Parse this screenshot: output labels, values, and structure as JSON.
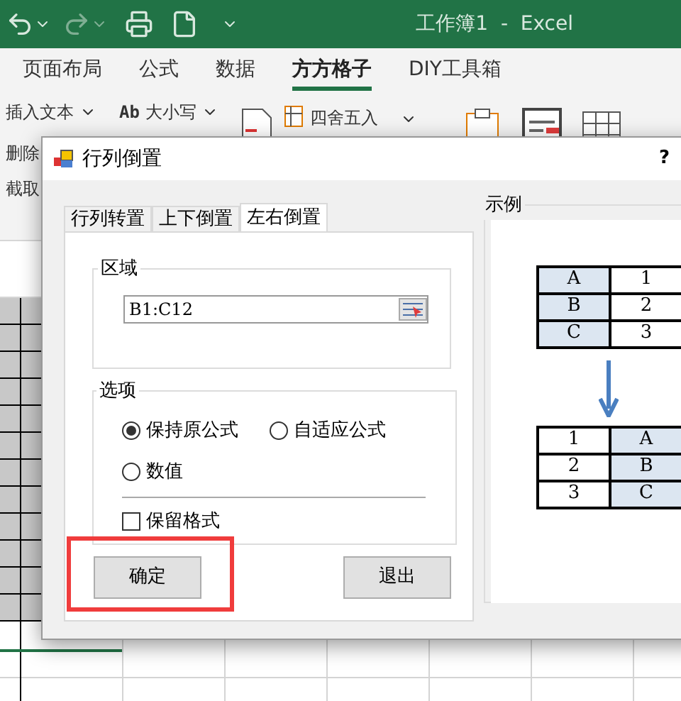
{
  "app": {
    "title": "工作簿1  -  Excel"
  },
  "ribbon_tabs": [
    {
      "label": "页面布局",
      "selected": false
    },
    {
      "label": "公式",
      "selected": false
    },
    {
      "label": "数据",
      "selected": false
    },
    {
      "label": "方方格子",
      "selected": true
    },
    {
      "label": "DIY工具箱",
      "selected": false
    }
  ],
  "ribbon_items": [
    {
      "label": "插入文本"
    },
    {
      "label": "大小写",
      "prefix": "Ab"
    },
    {
      "label": "四舍五入"
    }
  ],
  "ribbon_side_items": [
    "删除",
    "截取"
  ],
  "dialog": {
    "title": "行列倒置",
    "help": "?",
    "tabs": [
      {
        "label": "行列转置",
        "selected": false
      },
      {
        "label": "上下倒置",
        "selected": false
      },
      {
        "label": "左右倒置",
        "selected": true
      }
    ],
    "region": {
      "label": "区域",
      "value": "B1:C12"
    },
    "options": {
      "label": "选项",
      "radios": [
        {
          "label": "保持原公式",
          "selected": true
        },
        {
          "label": "自适应公式",
          "selected": false
        },
        {
          "label": "数值",
          "selected": false
        }
      ],
      "checkbox": {
        "label": "保留格式",
        "checked": false
      }
    },
    "buttons": [
      {
        "label": "确定",
        "highlighted": true
      },
      {
        "label": "退出",
        "highlighted": false
      }
    ],
    "example": {
      "label": "示例",
      "before": [
        [
          {
            "text": "A",
            "shaded": true
          },
          {
            "text": "1",
            "shaded": false
          }
        ],
        [
          {
            "text": "B",
            "shaded": true
          },
          {
            "text": "2",
            "shaded": false
          }
        ],
        [
          {
            "text": "C",
            "shaded": true
          },
          {
            "text": "3",
            "shaded": false
          }
        ]
      ],
      "after": [
        [
          {
            "text": "1",
            "shaded": false
          },
          {
            "text": "A",
            "shaded": true
          }
        ],
        [
          {
            "text": "2",
            "shaded": false
          },
          {
            "text": "B",
            "shaded": true
          }
        ],
        [
          {
            "text": "3",
            "shaded": false
          },
          {
            "text": "C",
            "shaded": true
          }
        ]
      ]
    }
  }
}
